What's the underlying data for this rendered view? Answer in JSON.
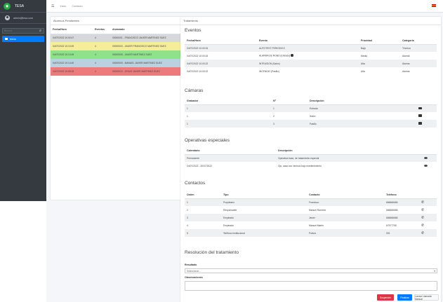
{
  "app": {
    "brand": "TESA",
    "user": "admin@tesa.com"
  },
  "sidebar": {
    "search_placeholder": "Buscar",
    "items": [
      {
        "label": "Inicio"
      }
    ]
  },
  "topbar": {
    "links": [
      "Inicio",
      "Contacto"
    ]
  },
  "alumnos": {
    "title": "Alumnos Pendientes",
    "headers": [
      "Fecha/Hora",
      "Eventos",
      "Alumnado"
    ],
    "rows": [
      {
        "fecha": "04/07/2022 10:00:47",
        "eventos": "4",
        "alumnado": "00000001 - FRANCISCO JAVIER MARTINEZ SUEZ"
      },
      {
        "fecha": "04/07/2022 10:10:49",
        "eventos": "4",
        "alumnado": "00000003 - JAVIER FRANCISCO MARTINEZ SUEZ"
      },
      {
        "fecha": "04/07/2022 10:10:49",
        "eventos": "4",
        "alumnado": "00000005 - JAVIER MARTINEZ SUEZ"
      },
      {
        "fecha": "04/07/2022 10:14:40",
        "eventos": "4",
        "alumnado": "00000009 - MANUEL JAVIER MARTINEZ SUEZ"
      },
      {
        "fecha": "04/07/2022 10:08:18",
        "eventos": "4",
        "alumnado": "00000010 - JESUS JAVIER MARTINEZ SUEZ"
      }
    ]
  },
  "tratamiento": {
    "title": "Tratamiento",
    "eventos": {
      "title": "Eventos",
      "headers": [
        "Fecha/Hora",
        "Evento",
        "Prioridad",
        "Categoría"
      ],
      "rows": [
        {
          "fecha": "04/07/2022 10:00:34",
          "evento": "AUTOTEST PERIODICO",
          "prioridad": "Baja",
          "categoria": "Técnica"
        },
        {
          "fecha": "04/07/2022 10:00:15",
          "evento": "ALARMA DE ROBO (Entrada)",
          "prioridad": "Media",
          "categoria": "Alarma"
        },
        {
          "fecha": "04/07/2022 10:00:22",
          "evento": "INTRUSION (Salón)",
          "prioridad": "Alta",
          "categoria": "Alarma"
        },
        {
          "fecha": "04/07/2022 10:00:22",
          "evento": "INCENDIO (Pasillo)",
          "prioridad": "Alta",
          "categoria": "Alarma"
        }
      ]
    },
    "camaras": {
      "title": "Cámaras",
      "headers": [
        "Grabador",
        "Nº",
        "Descripción"
      ],
      "rows": [
        {
          "grabador": "1",
          "num": "1",
          "desc": "Entrada"
        },
        {
          "grabador": "1",
          "num": "2",
          "desc": "Salón"
        },
        {
          "grabador": "1",
          "num": "3",
          "desc": "Pasillo"
        }
      ]
    },
    "operativas": {
      "title": "Operativas especiales",
      "headers": [
        "Calendario",
        "Descripción"
      ],
      "rows": [
        {
          "cal": "Permanente",
          "desc": "Operativa base, de tratamiento especial"
        },
        {
          "cal": "04/07/2022 - 30/07/2022",
          "desc": "Ojo, casa con vecinos bajo mantenimiento"
        }
      ]
    },
    "contactos": {
      "title": "Contactos",
      "headers": [
        "Orden",
        "Tipo",
        "Contacto",
        "Teléfono"
      ],
      "rows": [
        {
          "orden": "1",
          "tipo": "Propietario",
          "contacto": "Francisco",
          "tel": "666666666"
        },
        {
          "orden": "2",
          "tipo": "Responsable",
          "contacto": "Manuel Ramírez",
          "tel": "666666666"
        },
        {
          "orden": "3",
          "tipo": "Empleado",
          "contacto": "Javier",
          "tel": "666666666"
        },
        {
          "orden": "4",
          "tipo": "Empleado",
          "contacto": "Manuel Martín",
          "tel": "67577755"
        },
        {
          "orden": "5",
          "tipo": "Teléfono Institucional",
          "contacto": "Policía",
          "tel": "091"
        }
      ]
    },
    "resolucion": {
      "title": "Resolución del tratamiento",
      "resultado_label": "Resultado",
      "resultado_value": "Seleccionar...",
      "observaciones_label": "Observaciones",
      "btn_suspender": "Suspender",
      "btn_finalizar": "Finalizar",
      "btn_llamada": "Lanzar Llamada Manual"
    }
  },
  "colors": {
    "sidebar": "#343a40",
    "primary": "#007bff",
    "danger": "#dc3545"
  }
}
